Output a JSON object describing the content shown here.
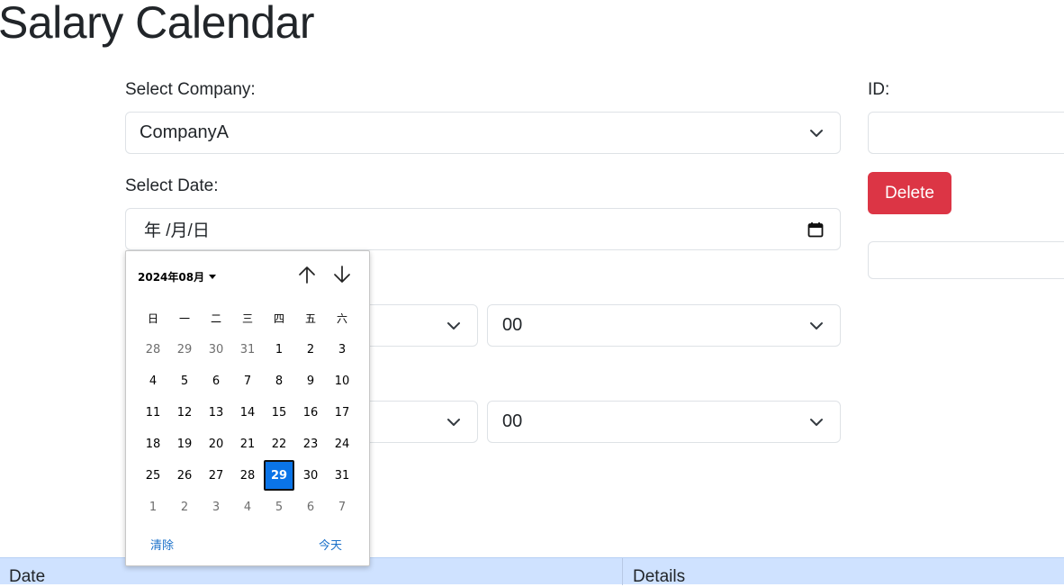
{
  "page": {
    "title": "Salary Calendar"
  },
  "form": {
    "company_label": "Select Company:",
    "company_value": "CompanyA",
    "date_label": "Select Date:",
    "date_value": "年 /月/日",
    "start_minute": "00",
    "end_minute": "00"
  },
  "side": {
    "id_label": "ID:",
    "id_value": "",
    "delete_label": "Delete",
    "extra_value": ""
  },
  "datepicker": {
    "month_label": "2024年08月",
    "weekdays": [
      "日",
      "一",
      "二",
      "三",
      "四",
      "五",
      "六"
    ],
    "weeks": [
      [
        "28",
        "29",
        "30",
        "31",
        "1",
        "2",
        "3"
      ],
      [
        "4",
        "5",
        "6",
        "7",
        "8",
        "9",
        "10"
      ],
      [
        "11",
        "12",
        "13",
        "14",
        "15",
        "16",
        "17"
      ],
      [
        "18",
        "19",
        "20",
        "21",
        "22",
        "23",
        "24"
      ],
      [
        "25",
        "26",
        "27",
        "28",
        "29",
        "30",
        "31"
      ],
      [
        "1",
        "2",
        "3",
        "4",
        "5",
        "6",
        "7"
      ]
    ],
    "selected_day": "29",
    "clear_label": "清除",
    "today_label": "今天"
  },
  "table": {
    "columns": [
      "Date",
      "Details"
    ]
  },
  "colors": {
    "danger": "#dc3545",
    "selected_day": "#0a74e8",
    "table_header": "#cfe2ff",
    "link": "#1a70c9"
  },
  "icons": {
    "select_arrow": "chevron-down-icon",
    "calendar": "calendar-icon",
    "prev": "arrow-up-icon",
    "next": "arrow-down-icon"
  }
}
